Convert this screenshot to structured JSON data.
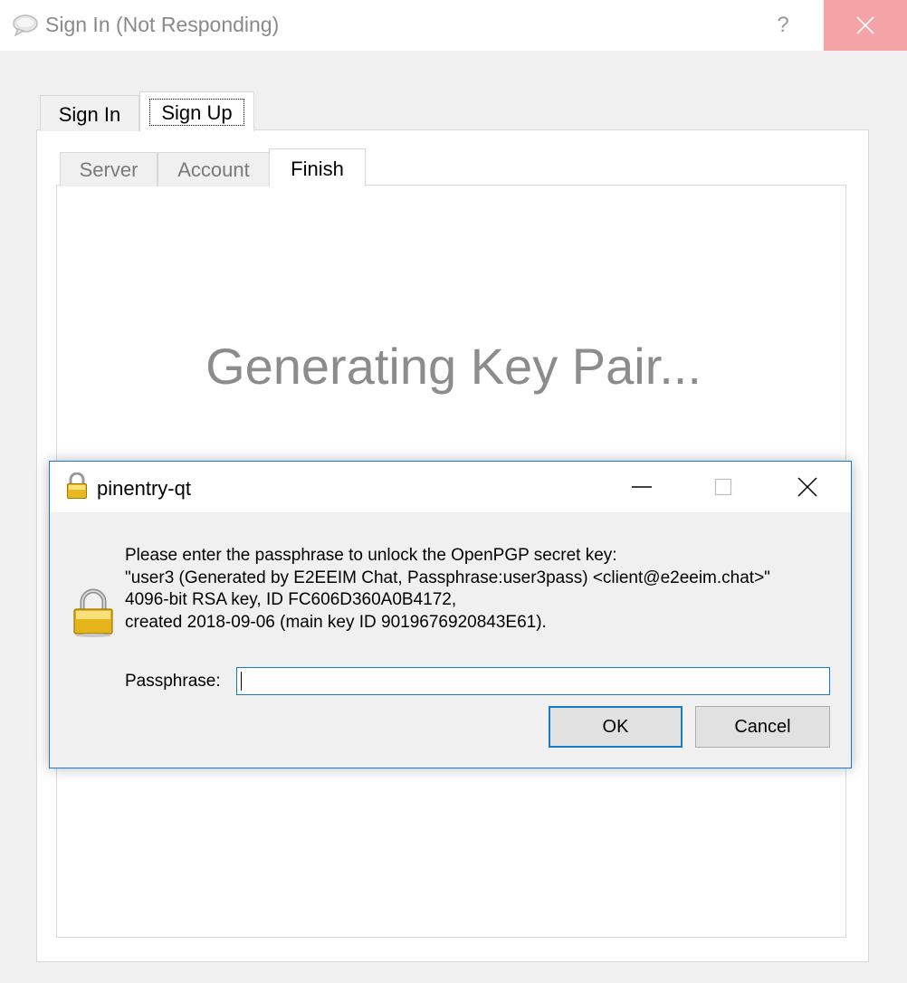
{
  "window": {
    "title": "Sign In (Not Responding)",
    "help_label": "?",
    "close_bg": "#f4a3a7"
  },
  "outer_tabs": [
    {
      "label": "Sign In",
      "selected": false
    },
    {
      "label": "Sign Up",
      "selected": true
    }
  ],
  "inner_tabs": [
    {
      "label": "Server",
      "selected": false
    },
    {
      "label": "Account",
      "selected": false
    },
    {
      "label": "Finish",
      "selected": true
    }
  ],
  "status_text": "Generating Key Pair...",
  "dialog": {
    "title": "pinentry-qt",
    "message_lines": [
      "Please enter the passphrase to unlock the OpenPGP secret key:",
      "\"user3 (Generated by E2EEIM Chat, Passphrase:user3pass) <client@e2eeim.chat>\"",
      "4096-bit RSA key, ID FC606D360A0B4172,",
      "created 2018-09-06 (main key ID 9019676920843E61)."
    ],
    "passphrase_label": "Passphrase:",
    "passphrase_value": "",
    "ok_label": "OK",
    "cancel_label": "Cancel",
    "accent_color": "#1979ca"
  }
}
